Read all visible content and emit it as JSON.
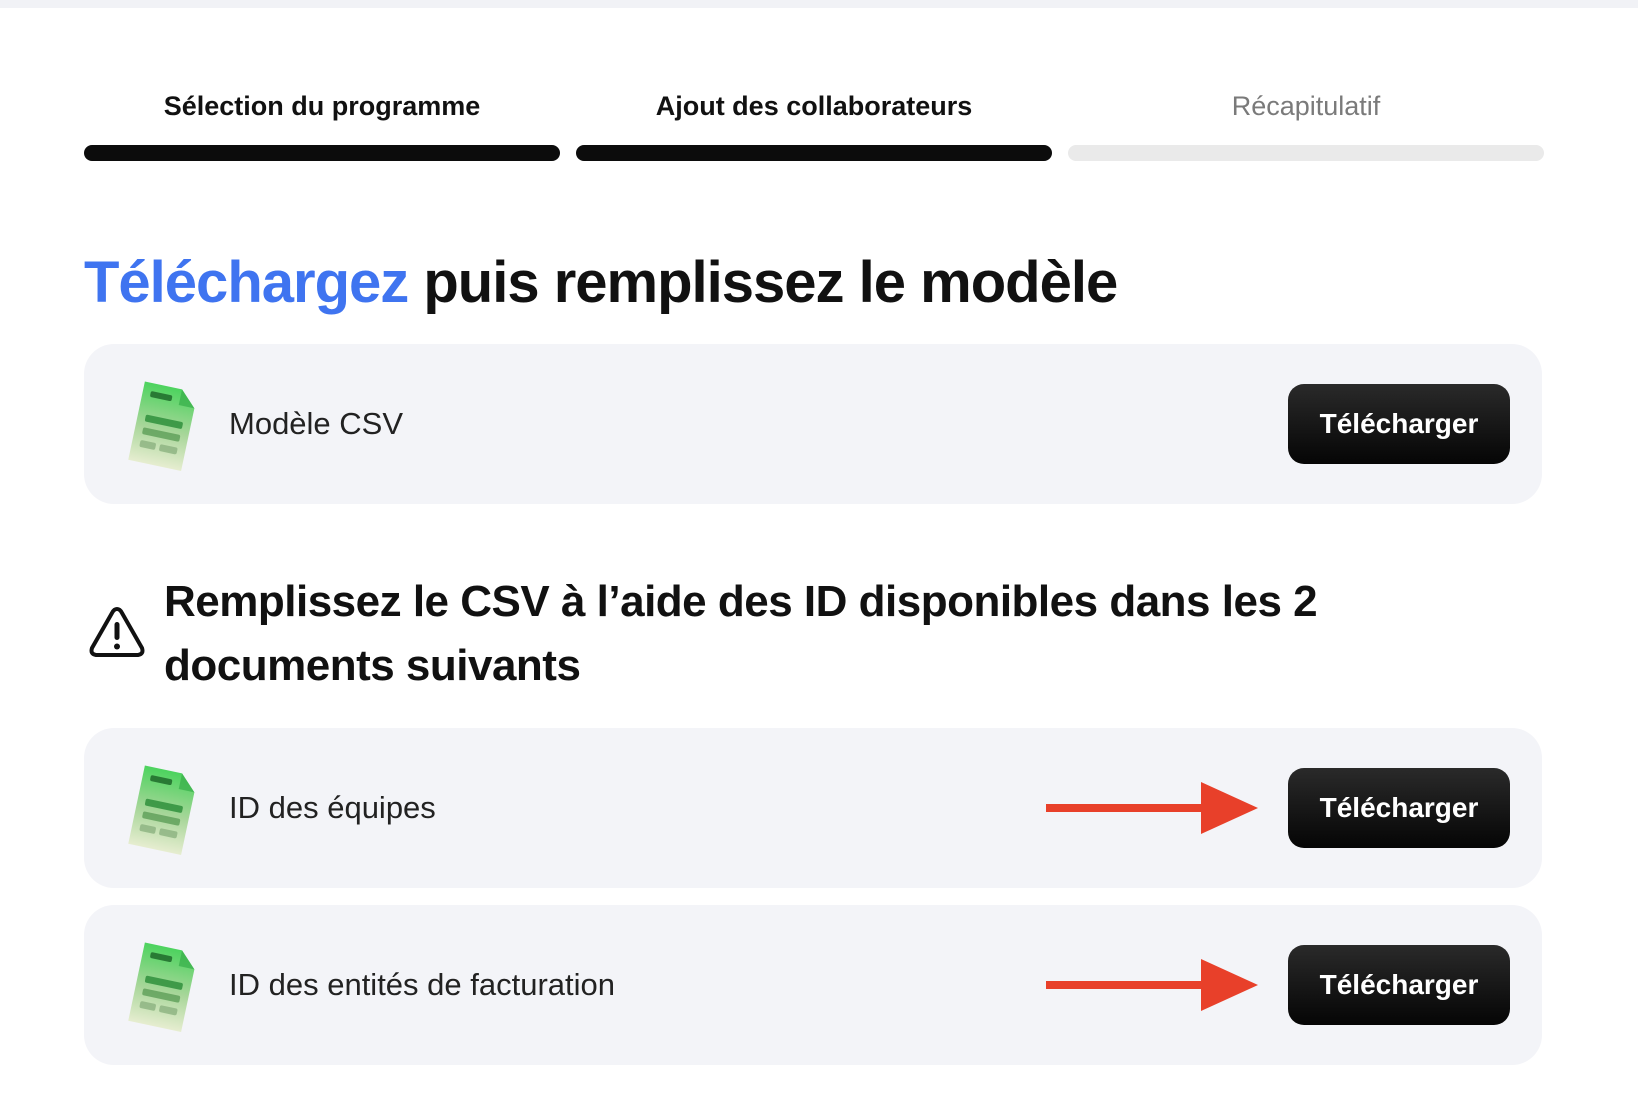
{
  "stepper": {
    "steps": [
      {
        "label": "Sélection du programme",
        "status": "completed"
      },
      {
        "label": "Ajout des collaborateurs",
        "status": "current"
      },
      {
        "label": "Récapitulatif",
        "status": "upcoming"
      }
    ],
    "colors": {
      "active": "#0c0c0c",
      "inactive": "#eaeaea"
    }
  },
  "headline": {
    "accent_word": "Téléchargez",
    "rest": " puis remplissez le modèle",
    "accent_color": "#3f74f0"
  },
  "template_card": {
    "icon": "csv-file-icon",
    "label": "Modèle CSV",
    "button_label": "Télécharger"
  },
  "warning": {
    "icon": "warning-triangle-icon",
    "text": "Remplissez le CSV à l’aide des ID disponibles dans les 2 documents suivants"
  },
  "documents": [
    {
      "icon": "csv-file-icon",
      "label": "ID des équipes",
      "button_label": "Télécharger",
      "pointer": "red-arrow-icon"
    },
    {
      "icon": "csv-file-icon",
      "label": "ID des entités de facturation",
      "button_label": "Télécharger",
      "pointer": "red-arrow-icon"
    }
  ],
  "colors": {
    "card_background": "#f3f4f8",
    "button_background": "#0c0c0c",
    "button_text": "#ffffff",
    "arrow": "#e8402a"
  }
}
